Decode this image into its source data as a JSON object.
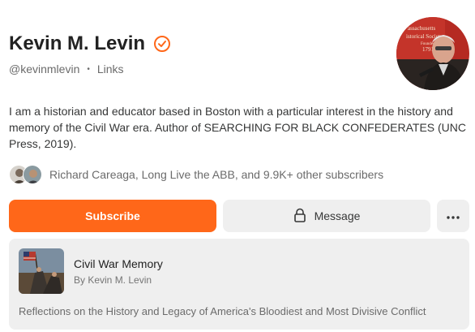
{
  "profile": {
    "name": "Kevin M. Levin",
    "handle": "@kevinmlevin",
    "separator": "•",
    "links_label": "Links",
    "bio": "I am a historian and educator based in Boston with a particular interest in the history and memory of the Civil War era. Author of SEARCHING FOR BLACK CONFEDERATES (UNC Press, 2019).",
    "verified_color": "#ff6719"
  },
  "subscribers": {
    "text": "Richard Careaga, Long Live the ABB, and 9.9K+ other subscribers"
  },
  "actions": {
    "subscribe_label": "Subscribe",
    "message_label": "Message",
    "more_label": "•••",
    "accent": "#ff6719"
  },
  "publication": {
    "title": "Civil War Memory",
    "author": "By Kevin M. Levin",
    "description": "Reflections on the History and Legacy of America's Bloodiest and Most Divisive Conflict"
  }
}
